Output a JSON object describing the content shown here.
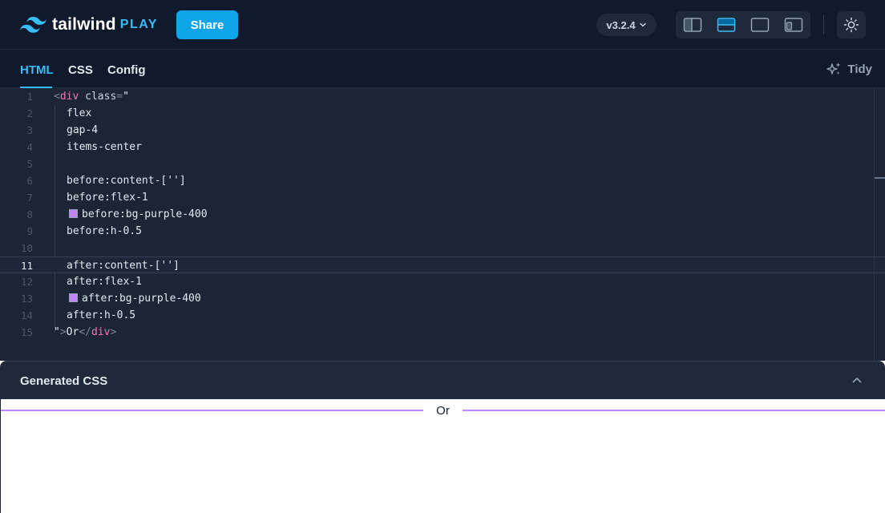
{
  "header": {
    "logo_text": "tailwind",
    "logo_play": "PLAY",
    "share_label": "Share",
    "version": "v3.2.4",
    "layout_icons": [
      "layout-split-vertical-icon",
      "layout-split-horizontal-icon",
      "layout-editor-only-icon",
      "layout-responsive-icon"
    ],
    "active_layout": "layout-split-horizontal-icon",
    "theme_icon": "sun-icon"
  },
  "tabs": {
    "items": [
      "HTML",
      "CSS",
      "Config"
    ],
    "active": "HTML",
    "tidy_label": "Tidy"
  },
  "editor": {
    "line_numbers": [
      "1",
      "2",
      "3",
      "4",
      "5",
      "6",
      "7",
      "8",
      "9",
      "10",
      "11",
      "12",
      "13",
      "14",
      "15"
    ],
    "active_line": "11",
    "lines": {
      "l1_lt": "<",
      "l1_tag": "div",
      "l1_attr": " class",
      "l1_eq": "=",
      "l1_quote": "\"",
      "l2": "flex",
      "l3": "gap-4",
      "l4": "items-center",
      "l6": "before:content-['']",
      "l7": "before:flex-1",
      "l8": "before:bg-purple-400",
      "l9": "before:h-0.5",
      "l11": "after:content-['']",
      "l12": "after:flex-1",
      "l13": "after:bg-purple-400",
      "l14": "after:h-0.5",
      "l15_quote": "\"",
      "l15_gt": ">",
      "l15_text": "Or",
      "l15_close_open": "</",
      "l15_close_tag": "div",
      "l15_close_gt": ">"
    },
    "swatch_color": "#c084fc"
  },
  "generated_css": {
    "title": "Generated CSS"
  },
  "preview": {
    "text": "Or",
    "line_color": "#c084fc"
  },
  "colors": {
    "accent": "#38bdf8",
    "share_bg": "#0ea5e9",
    "header_bg": "#111a2c",
    "editor_bg": "#1b2536",
    "tag_pink": "#f472b6"
  }
}
